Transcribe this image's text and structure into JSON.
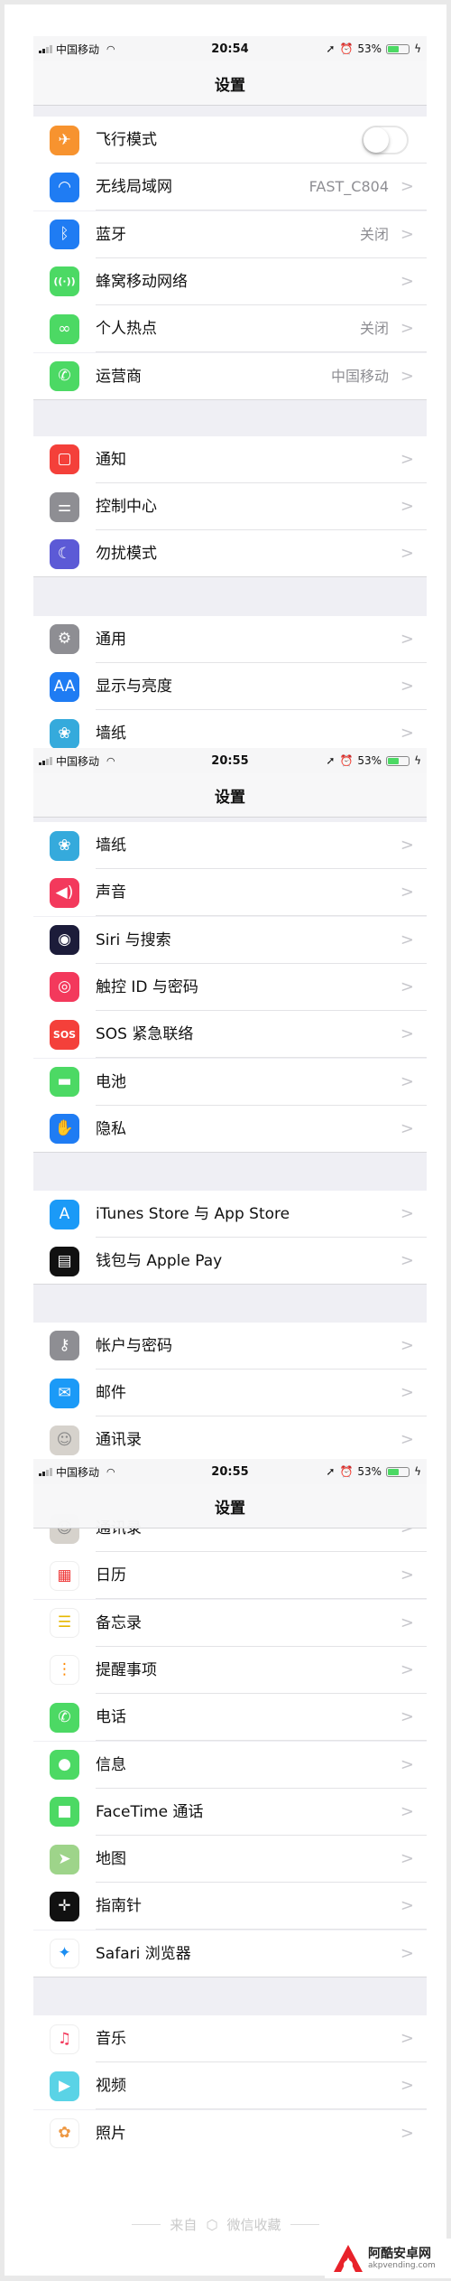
{
  "screens": [
    {
      "status": {
        "carrier": "中国移动",
        "time": "20:54",
        "battery": "53%",
        "battery_level": 0.53
      },
      "nav_title": "设置"
    },
    {
      "status": {
        "carrier": "中国移动",
        "time": "20:55",
        "battery": "53%",
        "battery_level": 0.53
      },
      "nav_title": "设置"
    },
    {
      "status": {
        "carrier": "中国移动",
        "time": "20:55",
        "battery": "53%",
        "battery_level": 0.53
      },
      "nav_title": "设置"
    }
  ],
  "groups": [
    {
      "screen": 0,
      "items": [
        {
          "label": "飞行模式",
          "icon": "airplane-icon",
          "color": "#f7932f",
          "toggle": true,
          "toggle_on": false
        },
        {
          "label": "无线局域网",
          "value": "FAST_C804",
          "icon": "wifi-icon",
          "color": "#1f7cf3"
        },
        {
          "label": "蓝牙",
          "value": "关闭",
          "icon": "bluetooth-icon",
          "color": "#1f7cf3"
        },
        {
          "label": "蜂窝移动网络",
          "icon": "cellular-icon",
          "color": "#4cd964"
        },
        {
          "label": "个人热点",
          "value": "关闭",
          "icon": "hotspot-icon",
          "color": "#4cd964"
        },
        {
          "label": "运营商",
          "value": "中国移动",
          "icon": "phone-icon",
          "color": "#4cd964"
        }
      ]
    },
    {
      "screen": 0,
      "items": [
        {
          "label": "通知",
          "icon": "notifications-icon",
          "color": "#f4403a"
        },
        {
          "label": "控制中心",
          "icon": "control-center-icon",
          "color": "#8e8e93"
        },
        {
          "label": "勿扰模式",
          "icon": "moon-icon",
          "color": "#5c5ad6"
        }
      ]
    },
    {
      "screen": 0,
      "items": [
        {
          "label": "通用",
          "icon": "gear-icon",
          "color": "#8e8e93"
        },
        {
          "label": "显示与亮度",
          "icon": "display-icon",
          "color": "#1f7cf3"
        },
        {
          "label": "墙纸",
          "icon": "wallpaper-icon",
          "color": "#35aadc"
        }
      ]
    },
    {
      "screen": 1,
      "items": [
        {
          "label": "墙纸",
          "icon": "wallpaper-icon",
          "color": "#35aadc"
        },
        {
          "label": "声音",
          "icon": "speaker-icon",
          "color": "#f3395c"
        },
        {
          "label": "Siri 与搜索",
          "icon": "siri-icon",
          "color": "#1c1c3a"
        },
        {
          "label": "触控 ID 与密码",
          "icon": "fingerprint-icon",
          "color": "#f3395c"
        },
        {
          "label": "SOS 紧急联络",
          "icon": "sos-icon",
          "color": "#f4403a"
        },
        {
          "label": "电池",
          "icon": "battery-icon",
          "color": "#4cd964"
        },
        {
          "label": "隐私",
          "icon": "hand-icon",
          "color": "#1f7cf3"
        }
      ]
    },
    {
      "screen": 1,
      "items": [
        {
          "label": "iTunes Store 与 App Store",
          "icon": "app-store-icon",
          "color": "#1b9af7"
        },
        {
          "label": "钱包与 Apple Pay",
          "icon": "wallet-icon",
          "color": "#111111"
        }
      ]
    },
    {
      "screen": 1,
      "items": [
        {
          "label": "帐户与密码",
          "icon": "key-icon",
          "color": "#8e8e93"
        },
        {
          "label": "邮件",
          "icon": "mail-icon",
          "color": "#1b9af7"
        },
        {
          "label": "通讯录",
          "icon": "contacts-icon",
          "color": "#d6d2cc"
        }
      ]
    },
    {
      "screen": 2,
      "items": [
        {
          "label": "通讯录",
          "icon": "contacts-icon",
          "color": "#d6d2cc"
        },
        {
          "label": "日历",
          "icon": "calendar-icon",
          "color": "#ffffff"
        },
        {
          "label": "备忘录",
          "icon": "notes-icon",
          "color": "#ffffff"
        },
        {
          "label": "提醒事项",
          "icon": "reminders-icon",
          "color": "#ffffff"
        },
        {
          "label": "电话",
          "icon": "phone-icon",
          "color": "#4cd964"
        },
        {
          "label": "信息",
          "icon": "messages-icon",
          "color": "#4cd964"
        },
        {
          "label": "FaceTime 通话",
          "icon": "facetime-icon",
          "color": "#4cd964"
        },
        {
          "label": "地图",
          "icon": "maps-icon",
          "color": "#9ed48a"
        },
        {
          "label": "指南针",
          "icon": "compass-icon",
          "color": "#111111"
        },
        {
          "label": "Safari 浏览器",
          "icon": "safari-icon",
          "color": "#ffffff"
        }
      ]
    },
    {
      "screen": 2,
      "items": [
        {
          "label": "音乐",
          "icon": "music-icon",
          "color": "#ffffff"
        },
        {
          "label": "视频",
          "icon": "videos-icon",
          "color": "#5ad3e6"
        },
        {
          "label": "照片",
          "icon": "photos-icon",
          "color": "#ffffff"
        }
      ]
    }
  ],
  "footer": {
    "prefix": "来自",
    "source": "微信收藏",
    "icon": "cube-icon"
  },
  "watermark": {
    "name": "阿酷安卓网",
    "domain": "akpvending.com",
    "color": "#e8222a"
  }
}
